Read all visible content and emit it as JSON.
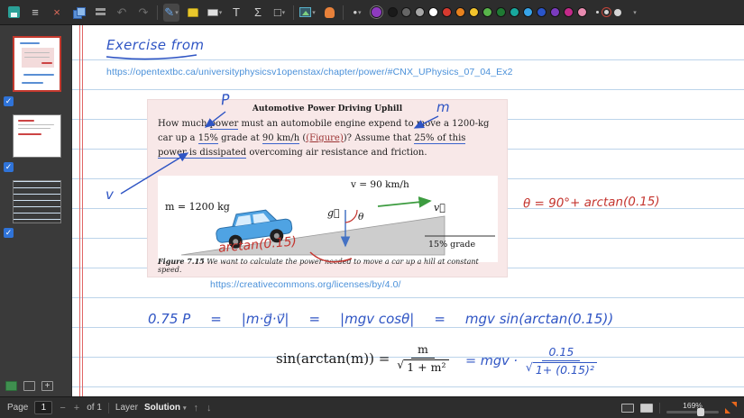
{
  "icons": {
    "menu": "≡",
    "close": "×",
    "undo": "↶",
    "redo": "↷",
    "pen": "✎",
    "text_tool": "T",
    "math_tool": "Σ",
    "shape_tool": "□",
    "caret": "▾",
    "dot": "•",
    "check": "✓",
    "minus": "−",
    "plus": "+",
    "layer_up": "↑",
    "layer_down": "↓",
    "add": "+"
  },
  "toolbar": {
    "active_color": "#8e3bbf",
    "palette": [
      "#1a1a1a",
      "#666666",
      "#a6a6a6",
      "#ffffff",
      "#d63a2f",
      "#e8821e",
      "#f2c42c",
      "#58b54a",
      "#1f7a33",
      "#18a89e",
      "#37a3e8",
      "#2a55c9",
      "#7a3bbf",
      "#c42a8a",
      "#e88bb0"
    ]
  },
  "page": {
    "heading": "Exercise from",
    "source_url": "https://opentextbc.ca/universityphysicsv1openstax/chapter/power/#CNX_UPhysics_07_04_Ex2",
    "license_url": "https://creativecommons.org/licenses/by/4.0/",
    "exercise": {
      "title": "Automotive Power Driving Uphill",
      "body": [
        "How much ",
        "power",
        " must an automobile engine expend to move a 1200-kg car up a ",
        "15%",
        " grade at ",
        "90 km/h",
        " (",
        "(Figure)",
        ")? Assume that ",
        "25% of this power is dissipated",
        " overcoming air resistance and friction."
      ],
      "figure": {
        "speed_label": "v = 90 km/h",
        "mass_label": "m = 1200 kg",
        "grade_label": "15% grade",
        "g_vector": "g⃗",
        "v_vector": "v⃗",
        "theta": "θ"
      },
      "caption_lead": "Figure 7.15",
      "caption_rest": " We want to calculate the power needed to move a car up a hill at constant speed."
    },
    "ink": {
      "power_label": "P",
      "mass_label": "m",
      "speed_label": "v",
      "angle_note": "arctan(0.15)",
      "theta_equation": "θ = 90°+ arctan(0.15)"
    },
    "work": {
      "term1": "0.75 P",
      "equals": "=",
      "term2": "|m·g⃗·v⃗|",
      "term3": "|mgv cosθ|",
      "term4": "mgv sin(arctan(0.15))",
      "identity_lhs": "sin(arctan(m)) =",
      "identity_numerator": "m",
      "radical": "√",
      "identity_radicand": "1 + m²",
      "result_lead": "= mgv ·",
      "result_numerator": "0.15",
      "result_radicand": "1+ (0.15)²"
    }
  },
  "statusbar": {
    "page_label": "Page",
    "page_value": "1",
    "of_label": "of 1",
    "layer_label": "Layer",
    "layer_value": "Solution",
    "zoom": "169%"
  }
}
